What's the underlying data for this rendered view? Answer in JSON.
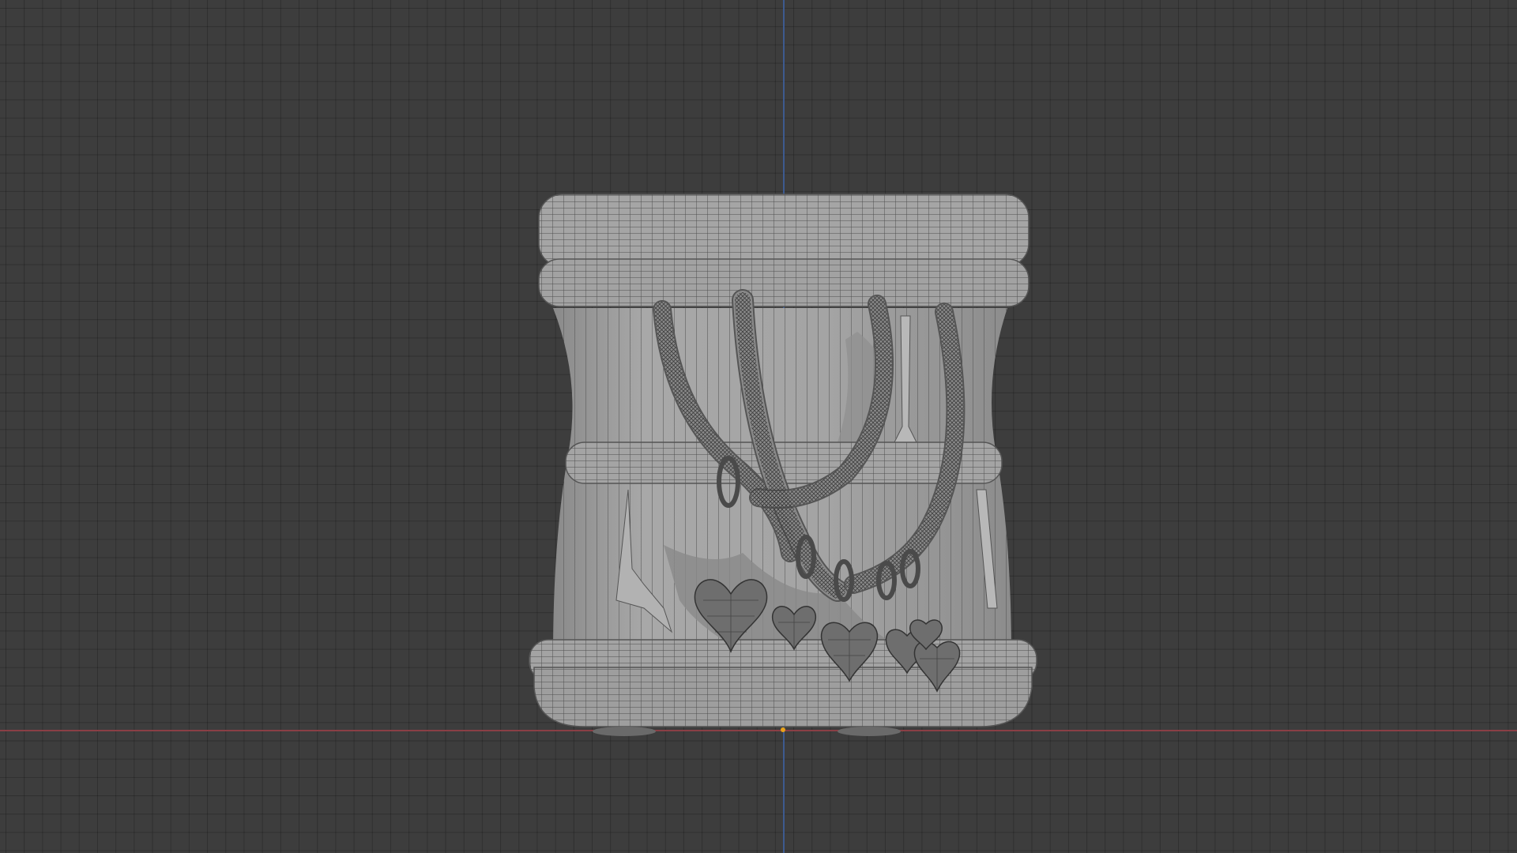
{
  "viewport": {
    "mode": "orthographic-front-wireframe-overlay",
    "background_color": "#3d3d3d",
    "grid_color": "#333333",
    "x_axis_color": "#8a3f45",
    "y_axis_color": "#3d5a8f",
    "origin_color": "#e8a21a",
    "mesh_color": "#a0a0a0",
    "wire_color": "#4a4a4a"
  },
  "model": {
    "name": "bracelet-with-heart-charms",
    "charm_icon": "heart-charm-icon"
  }
}
